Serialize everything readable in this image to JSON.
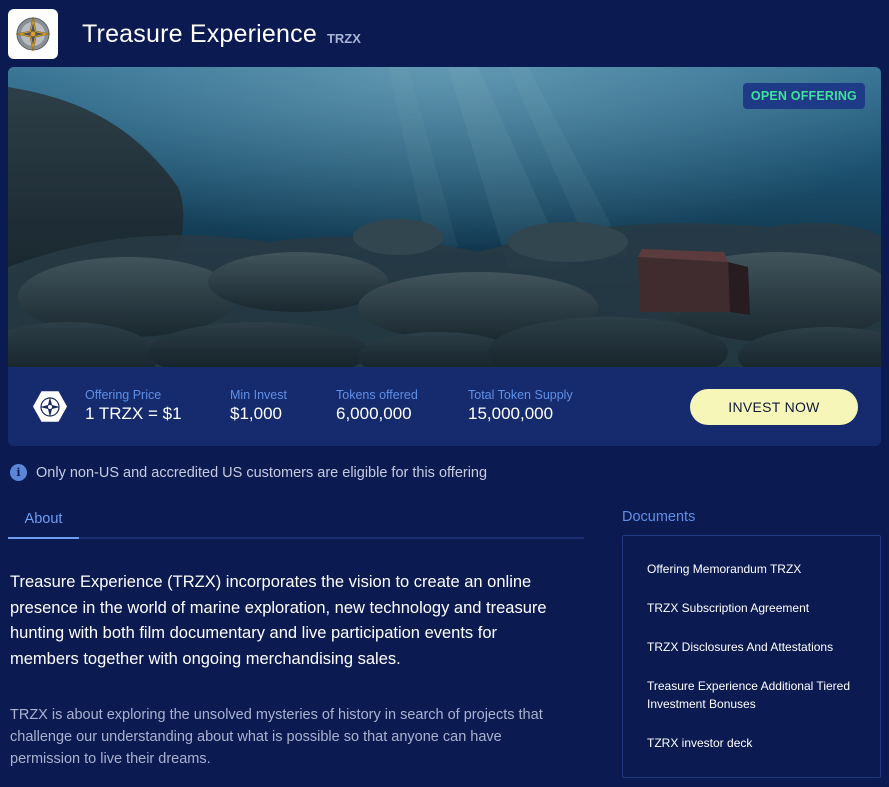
{
  "header": {
    "title": "Treasure Experience",
    "ticker": "TRZX",
    "logo_icon": "compass-rose-logo-icon"
  },
  "hero": {
    "badge": "OPEN OFFERING",
    "badge_color": "#3fe29c"
  },
  "stats": {
    "token_icon": "compass-hexagon-icon",
    "items": [
      {
        "label": "Offering Price",
        "value": "1 TRZX = $1"
      },
      {
        "label": "Min Invest",
        "value": "$1,000"
      },
      {
        "label": "Tokens offered",
        "value": "6,000,000"
      },
      {
        "label": "Total Token Supply",
        "value": "15,000,000"
      }
    ],
    "invest_label": "INVEST NOW",
    "invest_color": "#f7f6b9"
  },
  "notice": {
    "icon": "info-icon",
    "text": "Only non-US and accredited US customers are eligible for this offering"
  },
  "tabs": {
    "about": "About"
  },
  "about": {
    "main": "Treasure Experience (TRZX) incorporates the vision to create an online presence in the world of marine exploration, new technology and treasure hunting with both film documentary and live participation events for members together with ongoing merchandising sales.",
    "sub": "TRZX is about exploring the unsolved mysteries of history in search of projects that challenge our understanding about what is possible so that anyone can have permission to live their dreams."
  },
  "documents": {
    "heading": "Documents",
    "items": [
      "Offering Memorandum TRZX",
      "TRZX Subscription Agreement",
      "TRZX Disclosures And Attestations",
      "Treasure Experience Additional Tiered Investment Bonuses",
      "TZRX investor deck"
    ]
  },
  "colors": {
    "background": "#0b1b52",
    "accent": "#5f8fe6"
  }
}
